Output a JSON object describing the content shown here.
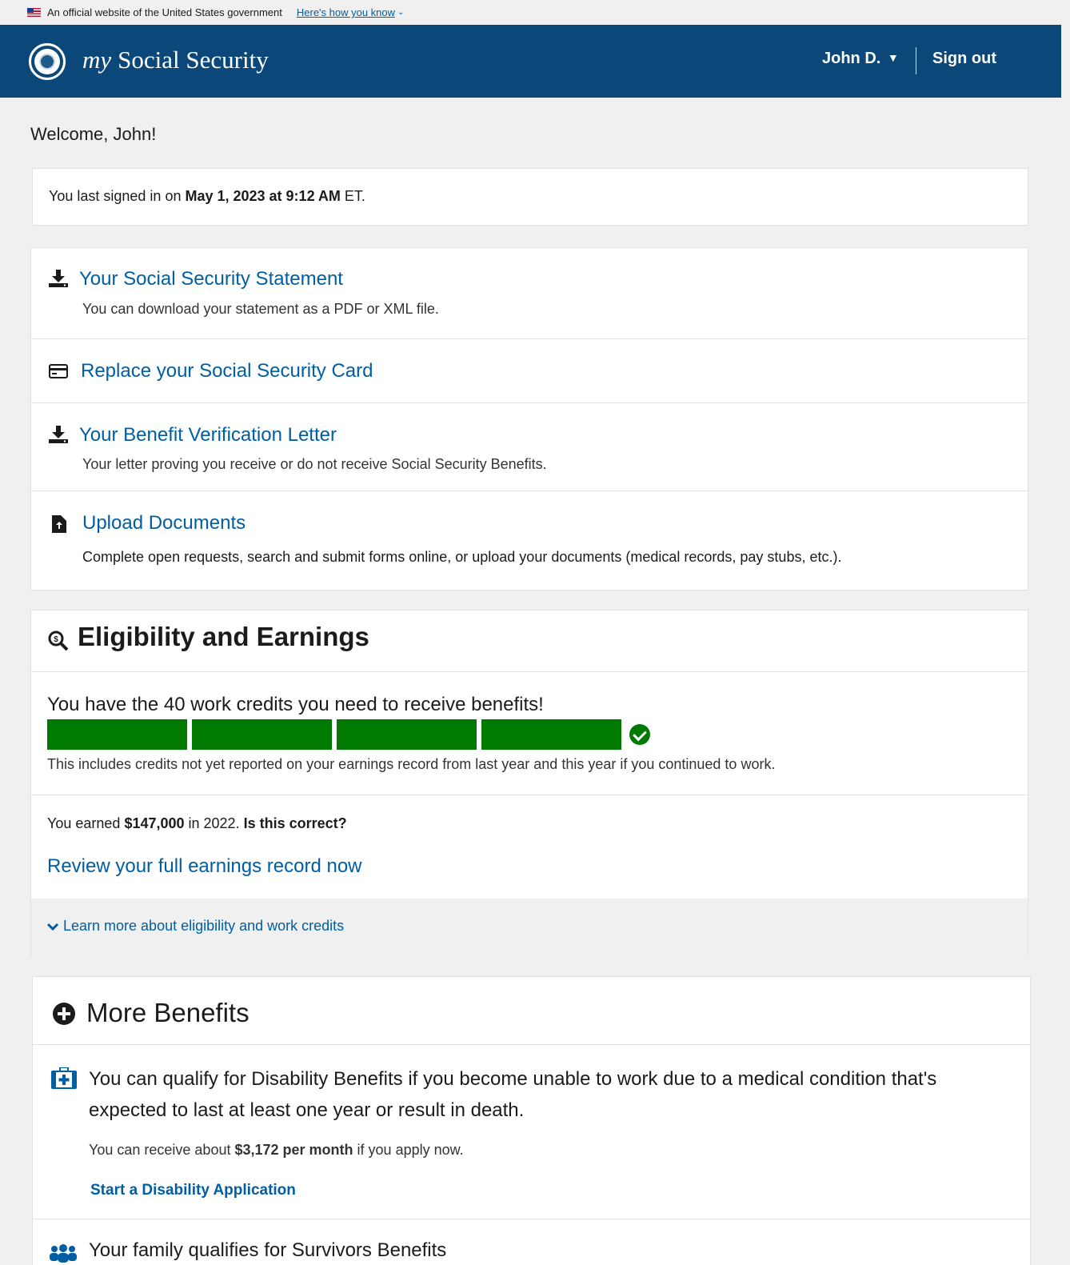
{
  "gov_banner": {
    "official_text": "An official website of the United States government",
    "how_you_know": "Here's how you know",
    "caret": "⌄"
  },
  "header": {
    "brand_my": "my",
    "brand_rest": "Social Security",
    "user_name": "John D.",
    "user_caret": "▼",
    "sign_out": "Sign out",
    "brand_color": "#0b4778"
  },
  "welcome": "Welcome, John!",
  "last_signed": {
    "prefix": "You last signed in on ",
    "datetime": "May 1, 2023 at 9:12 AM",
    "suffix": " ET."
  },
  "links": [
    {
      "icon": "download-icon",
      "title": "Your Social Security Statement",
      "desc": "You can download your statement as a PDF or XML file."
    },
    {
      "icon": "credit-card-icon",
      "title": "Replace your Social Security Card",
      "desc": ""
    },
    {
      "icon": "download-icon",
      "title": "Your Benefit Verification Letter",
      "desc": "Your letter proving you receive or do not receive Social Security Benefits."
    },
    {
      "icon": "file-upload-icon",
      "title": "Upload Documents",
      "desc": "Complete open requests, search and submit forms online, or upload your documents (medical records, pay stubs, etc.)."
    }
  ],
  "eligibility": {
    "title": "Eligibility and Earnings",
    "credits_text": "You have the 40 work credits you need to receive benefits!",
    "credits_progress": 1.0,
    "credits_note": "This includes credits not yet reported on your earnings record from last year and this year if you continued to work.",
    "earned_prefix": "You earned ",
    "earned_amount": "$147,000",
    "earned_mid": " in 2022. ",
    "earned_question": "Is this correct?",
    "review_link": "Review your full earnings record now",
    "learn_more": "Learn more about eligibility and work credits",
    "learn_caret": "⌄",
    "bar_color": "#007a00"
  },
  "more_benefits": {
    "title": "More Benefits",
    "disability_text": "You can qualify for Disability Benefits if you become unable to work due to a medical condition that's expected to last at least one year or result in death.",
    "receive_prefix": "You can receive about ",
    "receive_amount": "$3,172 per month",
    "receive_suffix": " if you apply now.",
    "start_app": "Start a Disability Application",
    "survivors_text": "Your family qualifies for Survivors Benefits"
  }
}
